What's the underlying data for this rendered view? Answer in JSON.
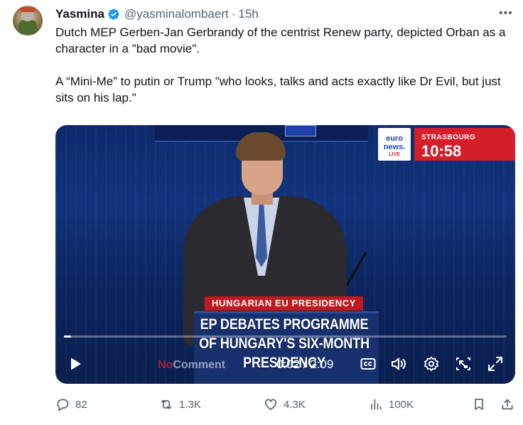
{
  "tweet": {
    "author_name": "Yasmina",
    "handle": "@yasminalombaert",
    "separator": "·",
    "time": "15h",
    "more_label": "•••",
    "paragraphs": [
      "Dutch MEP Gerben-Jan Gerbrandy of the centrist Renew party, depicted Orban as a character in a \"bad movie\".",
      "A “Mini-Me” to putin or Trump \"who looks, talks and acts exactly like Dr Evil, but just sits on his lap.\""
    ]
  },
  "video": {
    "brand_line1": "euro",
    "brand_line2": "news.",
    "brand_live": "LIVE",
    "location": "STRASBOURG",
    "clock": "10:58",
    "lower_third_tag": "HUNGARIAN EU PRESIDENCY",
    "headline_line1": "EP DEBATES PROGRAMME",
    "headline_line2": "OF HUNGARY'S SIX-MONTH PRESIDENCY",
    "watermark_red": "No",
    "watermark_white": "Comment",
    "time_display": "0:02 / 2:09",
    "progress_fraction": 0.0155
  },
  "actions": {
    "replies": "82",
    "reposts": "1.3K",
    "likes": "4.3K",
    "views": "100K"
  },
  "colors": {
    "verified": "#1d9bf0",
    "muted_text": "#536471",
    "badge_red": "#d41e2a"
  },
  "icons": [
    "verified-badge-icon",
    "more-icon",
    "play-icon",
    "closed-captions-icon",
    "volume-icon",
    "settings-gear-icon",
    "picture-in-picture-icon",
    "fullscreen-icon",
    "reply-icon",
    "repost-icon",
    "like-icon",
    "views-icon",
    "bookmark-icon",
    "share-icon"
  ]
}
